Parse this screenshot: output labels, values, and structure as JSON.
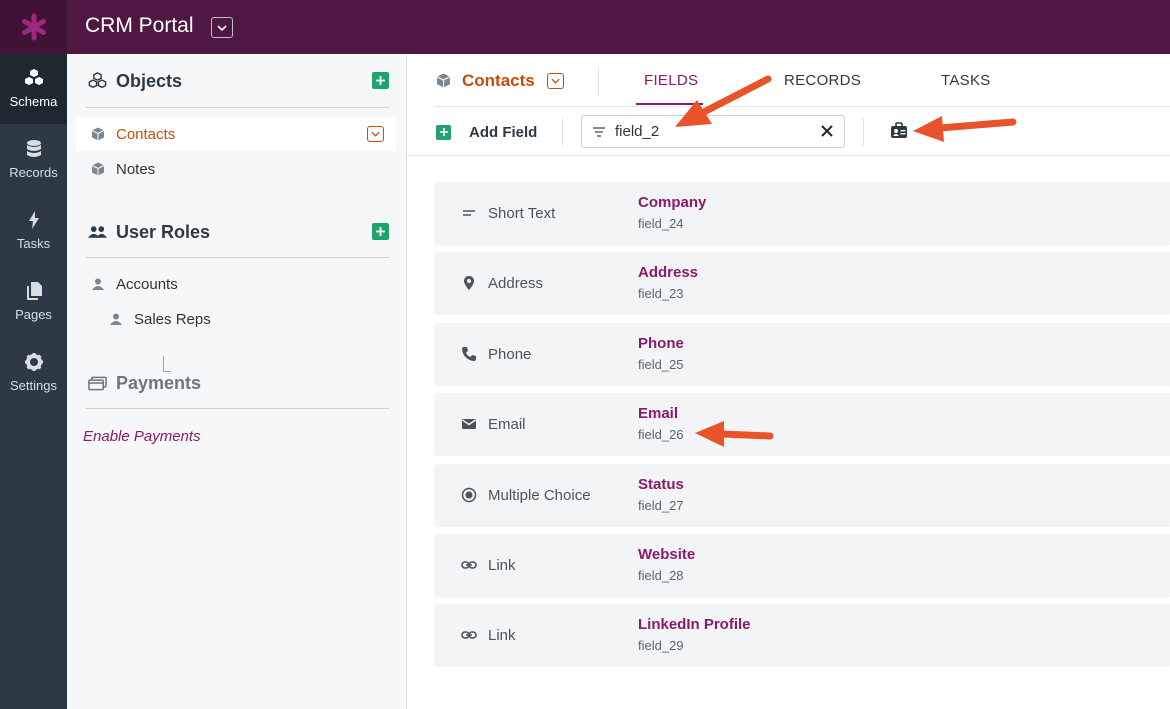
{
  "app": {
    "title": "CRM Portal"
  },
  "rail": [
    {
      "label": "Schema",
      "icon": "cubes-icon"
    },
    {
      "label": "Records",
      "icon": "database-icon"
    },
    {
      "label": "Tasks",
      "icon": "bolt-icon"
    },
    {
      "label": "Pages",
      "icon": "pages-icon"
    },
    {
      "label": "Settings",
      "icon": "gear-icon"
    }
  ],
  "objects": {
    "heading": "Objects",
    "items": [
      {
        "label": "Contacts",
        "active": true
      },
      {
        "label": "Notes",
        "active": false
      }
    ]
  },
  "user_roles": {
    "heading": "User Roles",
    "items": [
      {
        "label": "Accounts"
      },
      {
        "label": "Sales Reps"
      }
    ]
  },
  "payments": {
    "heading": "Payments",
    "enable_link": "Enable Payments"
  },
  "main": {
    "object_title": "Contacts",
    "tabs": [
      {
        "label": "FIELDS",
        "active": true
      },
      {
        "label": "RECORDS",
        "active": false
      },
      {
        "label": "TASKS",
        "active": false
      }
    ],
    "add_field_label": "Add Field",
    "filter_value": "field_2",
    "fields": [
      {
        "type": "Short Text",
        "icon": "short-text-icon",
        "name": "Company",
        "key": "field_24"
      },
      {
        "type": "Address",
        "icon": "map-pin-icon",
        "name": "Address",
        "key": "field_23"
      },
      {
        "type": "Phone",
        "icon": "phone-icon",
        "name": "Phone",
        "key": "field_25"
      },
      {
        "type": "Email",
        "icon": "envelope-icon",
        "name": "Email",
        "key": "field_26"
      },
      {
        "type": "Multiple Choice",
        "icon": "radio-icon",
        "name": "Status",
        "key": "field_27"
      },
      {
        "type": "Link",
        "icon": "link-icon",
        "name": "Website",
        "key": "field_28"
      },
      {
        "type": "Link",
        "icon": "link-icon",
        "name": "LinkedIn Profile",
        "key": "field_29"
      }
    ]
  },
  "colors": {
    "header": "#4e1842",
    "rail": "#2d3a45",
    "accent_orange": "#c44d0c",
    "accent_purple": "#8a1b6b",
    "add_green": "#21a36e",
    "annotation_arrow": "#e8532a"
  }
}
